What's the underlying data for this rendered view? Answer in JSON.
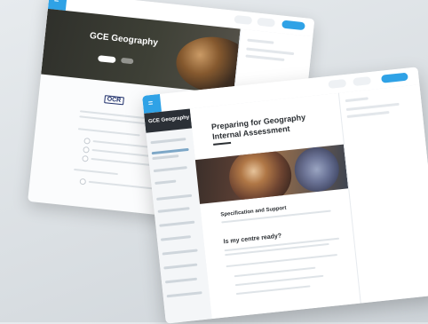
{
  "back_window": {
    "course_title": "GCE Geography",
    "logo_letter": "=",
    "breadcrumb": "",
    "subtitle": "",
    "provider_logo": "OCR"
  },
  "front_window": {
    "logo_letter": "=",
    "nav_title": "GCE Geography",
    "page_title": "Preparing for Geography Internal Assessment",
    "section_1_title": "Specification and Support",
    "section_2_title": "Is my centre ready?"
  },
  "colors": {
    "accent": "#2fa2e6",
    "nav_header": "#2b3036",
    "background": "#dde2e6"
  }
}
